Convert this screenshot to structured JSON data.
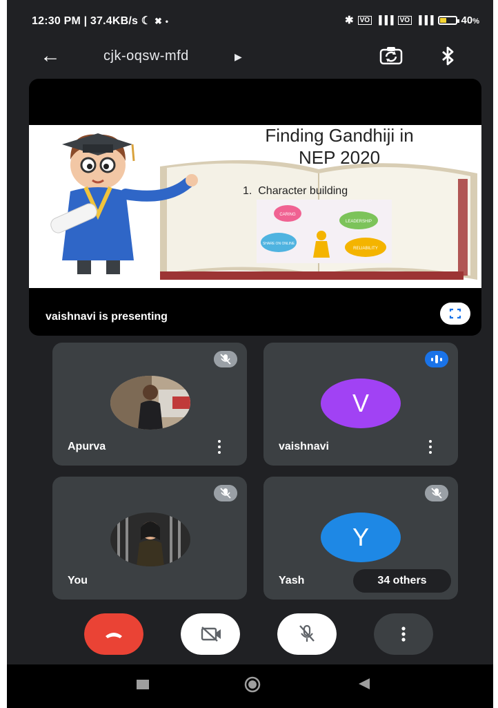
{
  "status_bar": {
    "time": "12:30 PM | 37.4KB/s",
    "battery": "40",
    "battery_fill_fraction": 0.4
  },
  "app_bar": {
    "meeting_code": "cjk-oqsw-mfd",
    "icons": [
      "back-arrow-icon",
      "caret-right-icon",
      "switch-camera-icon",
      "bluetooth-icon"
    ]
  },
  "presentation": {
    "slide_title_line1": "Finding Gandhiji in",
    "slide_title_line2": "NEP 2020",
    "slide_point": "1.  Character building",
    "slide_bubbles": [
      "CARING",
      "LEADERSHIP",
      "SHARE ON ONLINE",
      "RELIABILITY"
    ],
    "presenter_text": "vaishnavi is presenting"
  },
  "participants": [
    {
      "name": "Apurva",
      "status": "muted"
    },
    {
      "name": "vaishnavi",
      "initial": "V",
      "color": "#a142f4",
      "status": "speaking"
    },
    {
      "name": "You",
      "status": "muted"
    },
    {
      "name": "Yash",
      "initial": "Y",
      "color": "#1e88e5",
      "status": "muted"
    }
  ],
  "others_label": "34 others",
  "controls": {
    "end_call_color": "#ea4335",
    "icons": [
      "end-call-icon",
      "camera-off-icon",
      "mic-off-icon",
      "more-options-icon"
    ]
  }
}
